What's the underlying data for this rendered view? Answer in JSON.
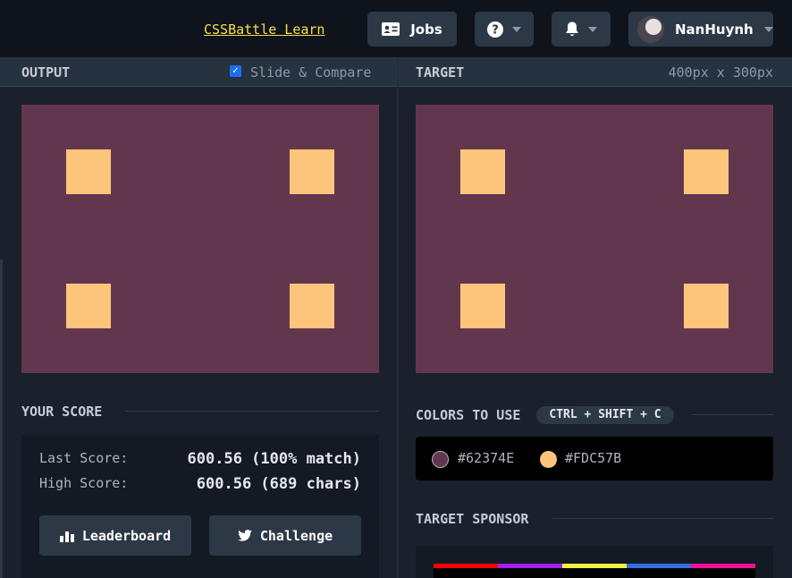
{
  "topbar": {
    "learn_link": "CSSBattle Learn",
    "jobs_label": "Jobs",
    "user_name": "NanHuynh"
  },
  "output_panel": {
    "title": "OUTPUT",
    "slide_compare_label": "Slide & Compare",
    "slide_compare_checked": true
  },
  "target_panel": {
    "title": "TARGET",
    "dimensions": "400px x 300px"
  },
  "canvas": {
    "background": "#62374E",
    "square_color": "#FDC57B"
  },
  "score": {
    "section_title": "YOUR SCORE",
    "last_label": "Last Score:",
    "last_value": "600.56 (100% match)",
    "high_label": "High Score:",
    "high_value": "600.56 (689 chars)",
    "leaderboard_label": "Leaderboard",
    "challenge_label": "Challenge"
  },
  "colors": {
    "section_title": "COLORS TO USE",
    "shortcut": "CTRL + SHIFT + C",
    "items": [
      {
        "hex": "#62374E",
        "swatch": "#62374E"
      },
      {
        "hex": "#FDC57B",
        "swatch": "#FDC57B"
      }
    ]
  },
  "sponsor": {
    "section_title": "TARGET SPONSOR",
    "stripe_colors": [
      "#ff0000",
      "#a020f0",
      "#f0f040",
      "#2f6fe0",
      "#f0109c"
    ]
  }
}
